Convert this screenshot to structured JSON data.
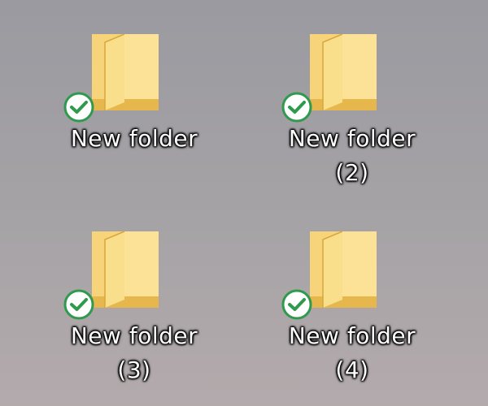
{
  "desktop": {
    "icons": [
      {
        "name_line1": "New folder",
        "name_line2": "",
        "status_icon": "sync-ok-check-icon"
      },
      {
        "name_line1": "New folder",
        "name_line2": "(2)",
        "status_icon": "sync-ok-check-icon"
      },
      {
        "name_line1": "New folder",
        "name_line2": "(3)",
        "status_icon": "sync-ok-check-icon"
      },
      {
        "name_line1": "New folder",
        "name_line2": "(4)",
        "status_icon": "sync-ok-check-icon"
      }
    ]
  },
  "colors": {
    "folder_body": "#f8d775",
    "folder_back": "#e8b84a",
    "check_green": "#3cb05a"
  }
}
